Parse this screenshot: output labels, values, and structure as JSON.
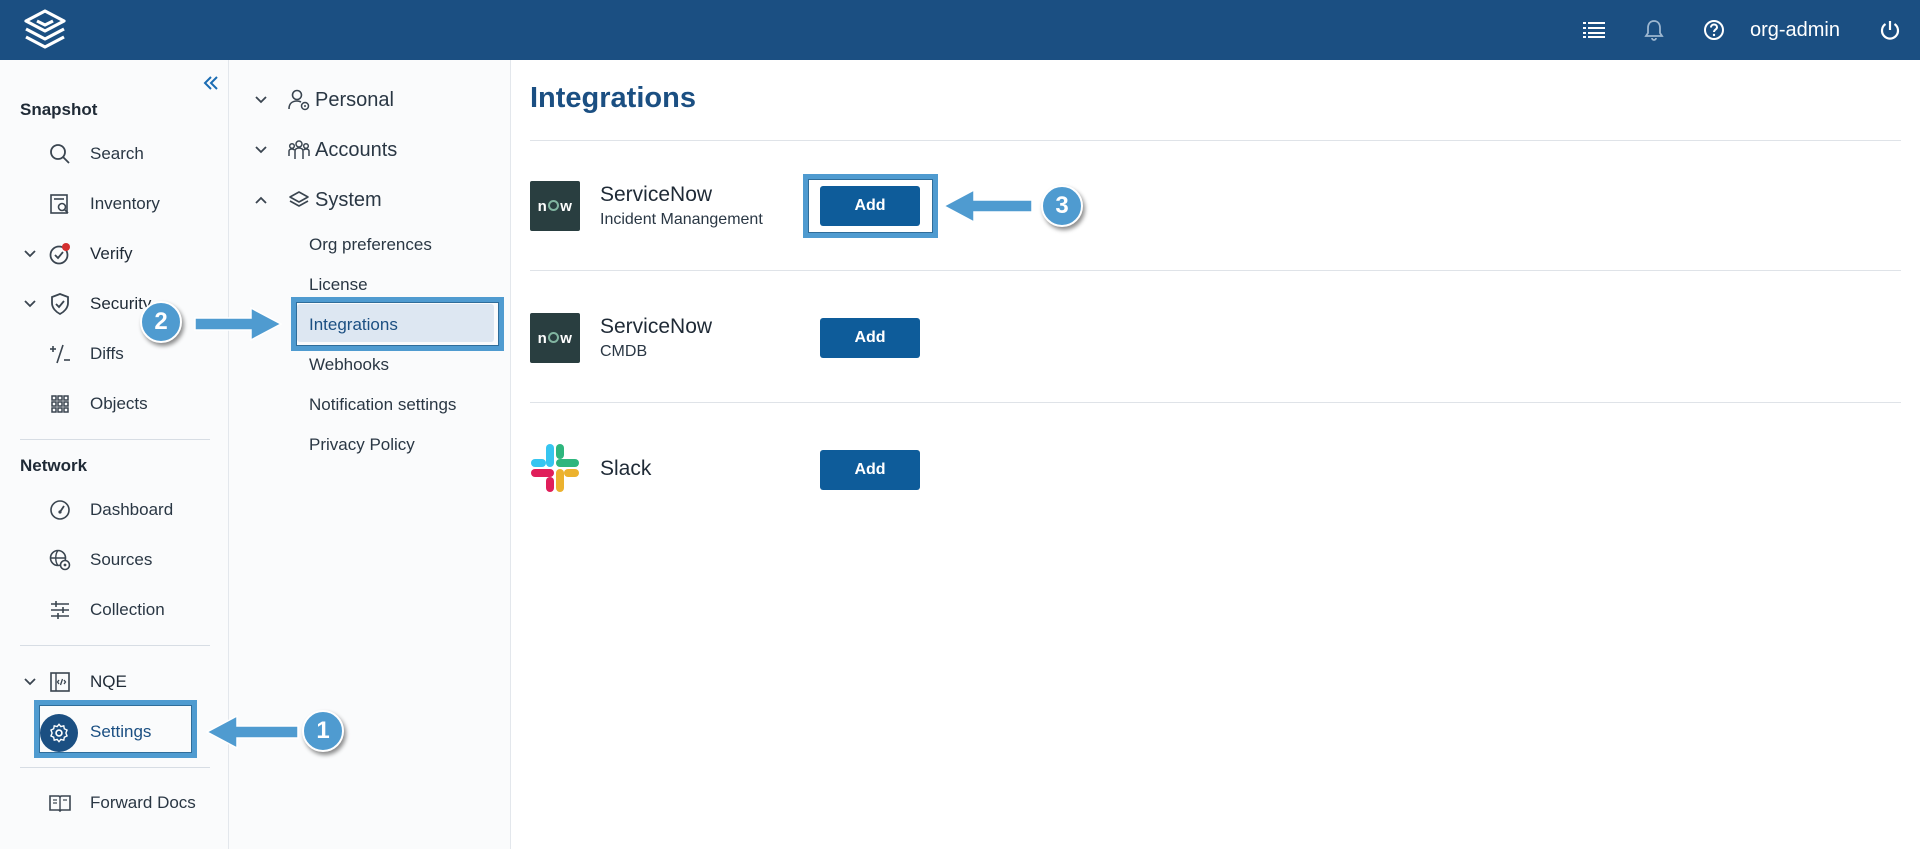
{
  "header": {
    "user": "org-admin"
  },
  "leftnav": {
    "snapshot_title": "Snapshot",
    "network_title": "Network",
    "items": {
      "search": "Search",
      "inventory": "Inventory",
      "verify": "Verify",
      "security": "Security",
      "diffs": "Diffs",
      "objects": "Objects",
      "dashboard": "Dashboard",
      "sources": "Sources",
      "collection": "Collection",
      "nqe": "NQE",
      "settings": "Settings",
      "forward_docs": "Forward Docs"
    }
  },
  "subnav": {
    "personal": "Personal",
    "accounts": "Accounts",
    "system": "System",
    "system_items": [
      "Org preferences",
      "License",
      "Integrations",
      "Webhooks",
      "Notification settings",
      "Privacy Policy"
    ],
    "selected": "Integrations"
  },
  "main": {
    "title": "Integrations",
    "integrations": [
      {
        "name": "ServiceNow",
        "subtitle": "Incident Manangement",
        "logo": "now",
        "button": "Add"
      },
      {
        "name": "ServiceNow",
        "subtitle": "CMDB",
        "logo": "now",
        "button": "Add"
      },
      {
        "name": "Slack",
        "subtitle": "",
        "logo": "slack-logo",
        "button": "Add"
      }
    ]
  },
  "annotations": {
    "step1": "1",
    "step2": "2",
    "step3": "3"
  },
  "colors": {
    "header": "#1b4f82",
    "accent": "#0e5c9a",
    "callout": "#4f9bd0"
  }
}
